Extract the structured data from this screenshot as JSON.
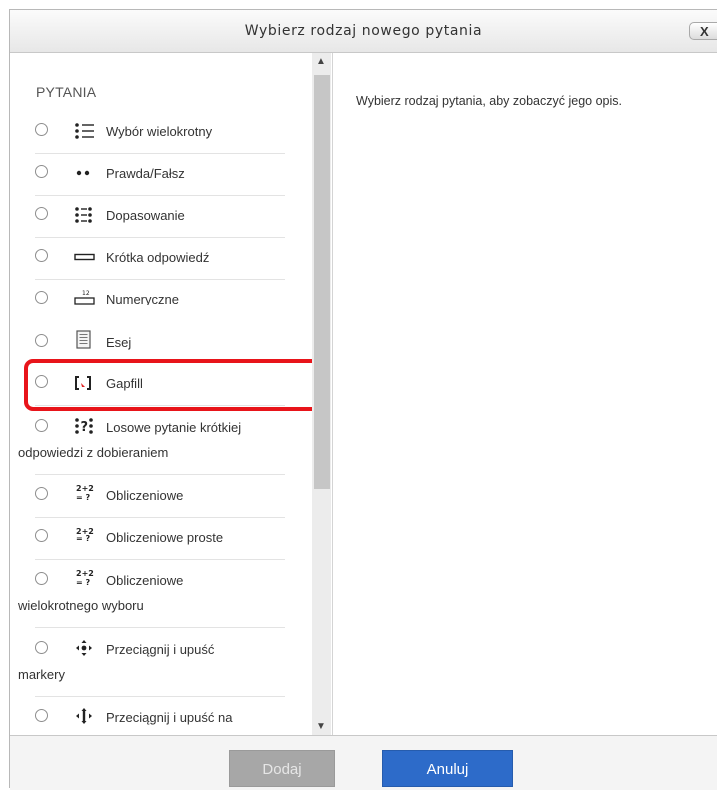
{
  "dialog": {
    "title": "Wybierz rodzaj nowego pytania",
    "close_label": "X"
  },
  "list": {
    "section_label": "PYTANIA",
    "items": [
      {
        "label": "Wybór wielokrotny",
        "icon": "multichoice-icon"
      },
      {
        "label": "Prawda/Fałsz",
        "icon": "truefalse-icon"
      },
      {
        "label": "Dopasowanie",
        "icon": "match-icon"
      },
      {
        "label": "Krótka odpowiedź",
        "icon": "shortanswer-icon"
      },
      {
        "label": "Numeryczne",
        "icon": "numerical-icon"
      },
      {
        "label": "Esej",
        "icon": "essay-icon"
      },
      {
        "label": "Gapfill",
        "icon": "gapfill-icon"
      },
      {
        "label": "Losowe pytanie krótkiej",
        "label_cont": "odpowiedzi z dobieraniem",
        "icon": "randomsamatch-icon"
      },
      {
        "label": "Obliczeniowe",
        "icon": "calculated-icon"
      },
      {
        "label": "Obliczeniowe proste",
        "icon": "calculatedsimple-icon"
      },
      {
        "label": "Obliczeniowe",
        "label_cont": "wielokrotnego wyboru",
        "icon": "calculatedmulti-icon"
      },
      {
        "label": "Przeciągnij i upuść",
        "label_cont": "markery",
        "icon": "ddmarker-icon"
      },
      {
        "label": "Przeciągnij i upuść na",
        "icon": "ddimageortext-icon"
      }
    ]
  },
  "description": {
    "text": "Wybierz rodzaj pytania, aby zobaczyć jego opis."
  },
  "footer": {
    "add_label": "Dodaj",
    "cancel_label": "Anuluj"
  },
  "colors": {
    "highlight": "#e8141a",
    "primary_button": "#2d6bc9",
    "disabled_button": "#a7a7a7"
  }
}
